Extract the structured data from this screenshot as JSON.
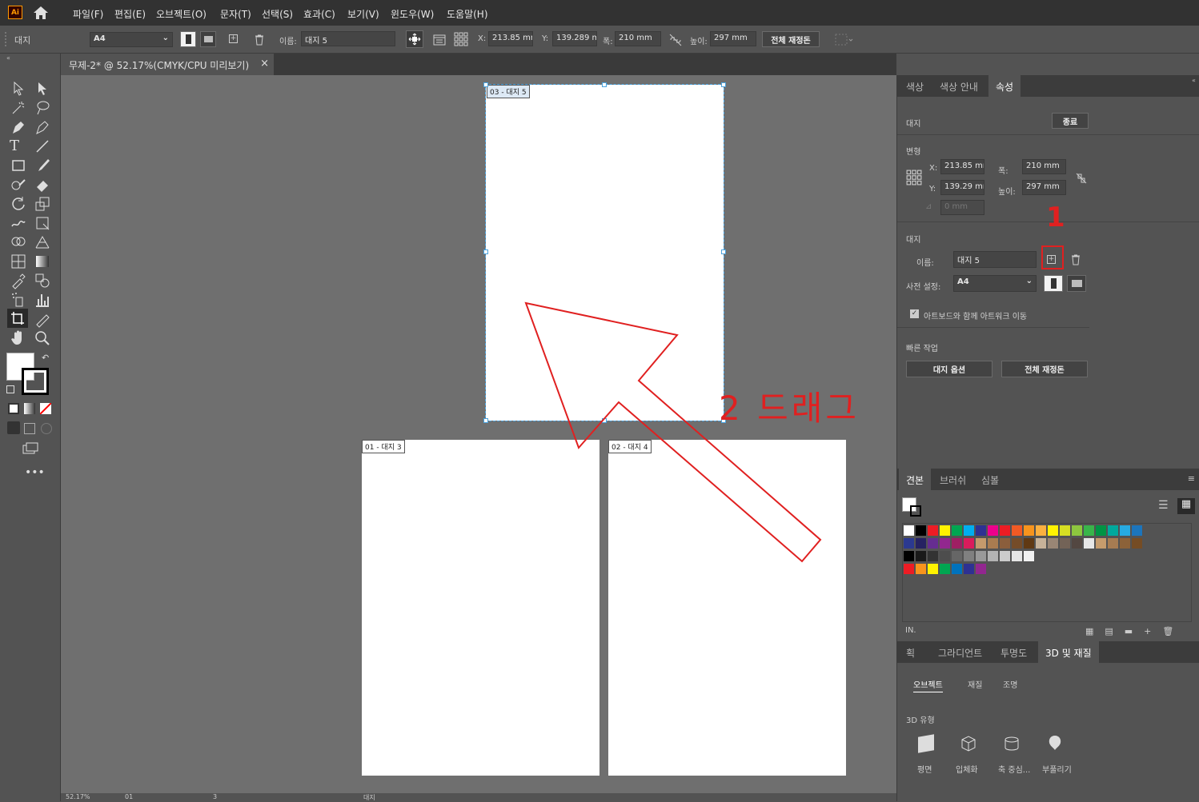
{
  "menu": {
    "logo": "Ai",
    "items": [
      "파일(F)",
      "편집(E)",
      "오브젝트(O)",
      "문자(T)",
      "선택(S)",
      "효과(C)",
      "보기(V)",
      "윈도우(W)",
      "도움말(H)"
    ]
  },
  "control": {
    "mode_label": "대지",
    "preset": "A4",
    "name_label": "이름:",
    "name_value": "대지 5",
    "x_label": "X:",
    "x_value": "213.85 mm",
    "y_label": "Y:",
    "y_value": "139.289 m",
    "w_label": "폭:",
    "w_value": "210 mm",
    "h_label": "높이:",
    "h_value": "297 mm",
    "rearrange_button": "전체 재정돈"
  },
  "document": {
    "tab_title": "무제-2* @ 52.17%(CMYK/CPU 미리보기)",
    "close": "×"
  },
  "artboards": [
    {
      "label": "03 - 대지 5"
    },
    {
      "label": "01 - 대지 3"
    },
    {
      "label": "02 - 대지 4"
    }
  ],
  "annotations": {
    "step1": "1",
    "step2": "2 드래그",
    "color": "#e02020"
  },
  "properties": {
    "tabs": [
      "색상",
      "색상 안내",
      "속성"
    ],
    "active_tab": "속성",
    "section_artboard": "대지",
    "exit_button": "종료",
    "transform_title": "변형",
    "x_label": "X:",
    "x_value": "213.85 mr",
    "y_label": "Y:",
    "y_value": "139.29 mr",
    "w_label": "폭:",
    "w_value": "210 mm",
    "h_label": "높이:",
    "h_value": "297 mm",
    "angle_value": "0 mm",
    "artboard_title": "대지",
    "name_label": "이름:",
    "name_value": "대지 5",
    "preset_label": "사전 설정:",
    "preset_value": "A4",
    "move_artwork_label": "아트보드와 함께 아트워크 이동",
    "move_artwork_checked": true,
    "quick_actions_title": "빠른 작업",
    "artboard_options_button": "대지 옵션",
    "rearrange_all_button": "전체 재정돈"
  },
  "swatches_panel": {
    "tabs": [
      "견본",
      "브러쉬",
      "심볼"
    ],
    "active_tab": "견본",
    "row1": [
      "#ffffff",
      "#000000",
      "#ee1c25",
      "#fff200",
      "#00a651",
      "#00aeef",
      "#2e3192",
      "#ec008c",
      "#ed1c24",
      "#f15a24",
      "#f7941d",
      "#fbb040",
      "#fff200",
      "#d7df23",
      "#8dc63f",
      "#39b54a",
      "#009444",
      "#00a99d",
      "#27aae1",
      "#1c75bc"
    ],
    "row2": [
      "#2b3990",
      "#262262",
      "#662d91",
      "#92278f",
      "#9e1f63",
      "#da1c5c",
      "#c49a6c",
      "#a97c50",
      "#8b5e3c",
      "#754c29",
      "#603913",
      "#c7b299",
      "#998675",
      "#736357",
      "#534741",
      "#e6e6e6",
      "#c69c6d",
      "#a67c52",
      "#8c6239",
      "#754c24"
    ],
    "row3": [
      "#000000",
      "#1a1a1a",
      "#333333",
      "#4d4d4d",
      "#666666",
      "#808080",
      "#999999",
      "#b3b3b3",
      "#cccccc",
      "#e6e6e6",
      "#f2f2f2"
    ],
    "row4": [
      "#ed1c24",
      "#f7941d",
      "#fff200",
      "#00a651",
      "#0072bc",
      "#2e3192",
      "#92278f"
    ]
  },
  "bottom_panel": {
    "tabs": [
      "획",
      "그라디언트",
      "투명도",
      "3D 및 재질"
    ],
    "active_tab": "3D 및 재질",
    "subtabs": [
      "오브젝트",
      "재질",
      "조명"
    ],
    "type_title": "3D 유형",
    "types": [
      "평면",
      "입체화",
      "축 중심...",
      "부풀리기"
    ]
  },
  "status": {
    "zoom": "52.17%",
    "artboard_no": "01",
    "page": "3",
    "tool": "대지"
  }
}
